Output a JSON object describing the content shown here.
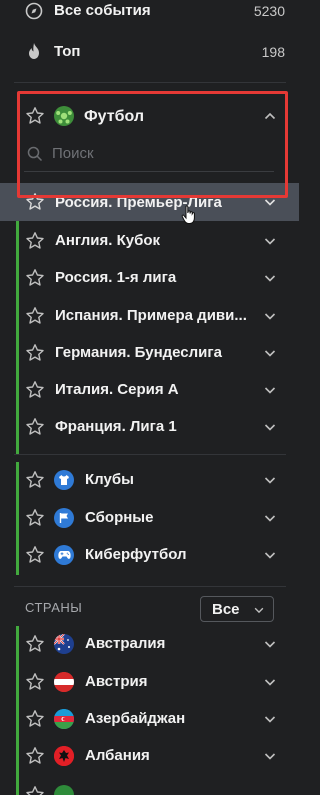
{
  "top_nav": {
    "all_events": {
      "label": "Все события",
      "count": "5230"
    },
    "top": {
      "label": "Топ",
      "count": "198"
    }
  },
  "sport": {
    "name": "Футбол",
    "search_placeholder": "Поиск",
    "leagues": [
      {
        "label": "Россия. Премьер-Лига"
      },
      {
        "label": "Англия. Кубок"
      },
      {
        "label": "Россия. 1-я лига"
      },
      {
        "label": "Испания. Примера диви..."
      },
      {
        "label": "Германия. Бундеслига"
      },
      {
        "label": "Италия. Серия А"
      },
      {
        "label": "Франция. Лига 1"
      }
    ],
    "categories": [
      {
        "label": "Клубы",
        "icon": "shirt-icon"
      },
      {
        "label": "Сборные",
        "icon": "flag-icon"
      },
      {
        "label": "Киберфутбол",
        "icon": "gamepad-icon"
      }
    ]
  },
  "countries": {
    "section_title": "СТРАНЫ",
    "filter_value": "Все",
    "items": [
      {
        "label": "Австралия",
        "icon": "australia-flag-icon"
      },
      {
        "label": "Австрия",
        "icon": "austria-flag-icon"
      },
      {
        "label": "Азербайджан",
        "icon": "azerbaijan-flag-icon"
      },
      {
        "label": "Албания",
        "icon": "albania-flag-icon"
      }
    ]
  },
  "colors": {
    "background": "#1f2022",
    "highlight_row": "#4a4f58",
    "accent_green": "#42a93e",
    "annotation_red": "#e53935",
    "icon_blue": "#2f7ad6"
  }
}
